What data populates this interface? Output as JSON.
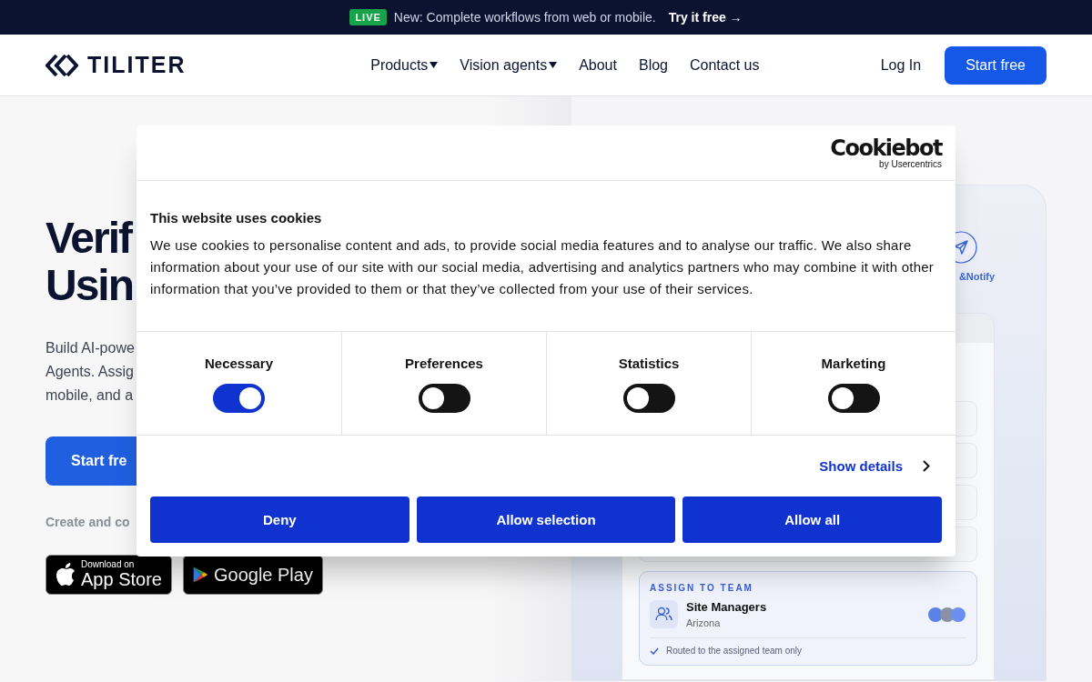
{
  "announcement": {
    "badge": "LIVE",
    "text": "New: Complete workflows from web or mobile.",
    "link": "Try it free →"
  },
  "nav": {
    "logo": "TILITER",
    "items": [
      {
        "label": "Products",
        "dropdown": true
      },
      {
        "label": "Vision agents",
        "dropdown": true
      },
      {
        "label": "About",
        "dropdown": false
      },
      {
        "label": "Blog",
        "dropdown": false
      },
      {
        "label": "Contact us",
        "dropdown": false
      }
    ],
    "login": "Log In",
    "cta": "Start free"
  },
  "hero": {
    "heading_lines": [
      "Verif",
      "Usin"
    ],
    "paragraph_lines": [
      "Build AI-powe",
      "Agents. Assig",
      "mobile, and a"
    ],
    "cta": "Start fre",
    "caption": "Create and co",
    "badges": [
      {
        "kind": "apple",
        "small": "Download on",
        "big": "App Store"
      },
      {
        "kind": "google",
        "big": "Google Play"
      }
    ]
  },
  "mock": {
    "step_label": "&Notify",
    "assign_card": {
      "title": "ASSIGN TO TEAM",
      "team": "Site Managers",
      "location": "Arizona",
      "note": "Routed to the assigned team only"
    }
  },
  "cookie_dialog": {
    "brand": "Cookiebot",
    "brand_sub": "by Usercentrics",
    "title": "This website uses cookies",
    "body": "We use cookies to personalise content and ads, to provide social media features and to analyse our traffic. We also share information about your use of our site with our social media, advertising and analytics partners who may combine it with other information that you’ve provided to them or that they’ve collected from your use of their services.",
    "categories": [
      {
        "label": "Necessary",
        "on": true
      },
      {
        "label": "Preferences",
        "on": false
      },
      {
        "label": "Statistics",
        "on": false
      },
      {
        "label": "Marketing",
        "on": false
      }
    ],
    "details_link": "Show details",
    "buttons": [
      "Deny",
      "Allow selection",
      "Allow all"
    ]
  }
}
